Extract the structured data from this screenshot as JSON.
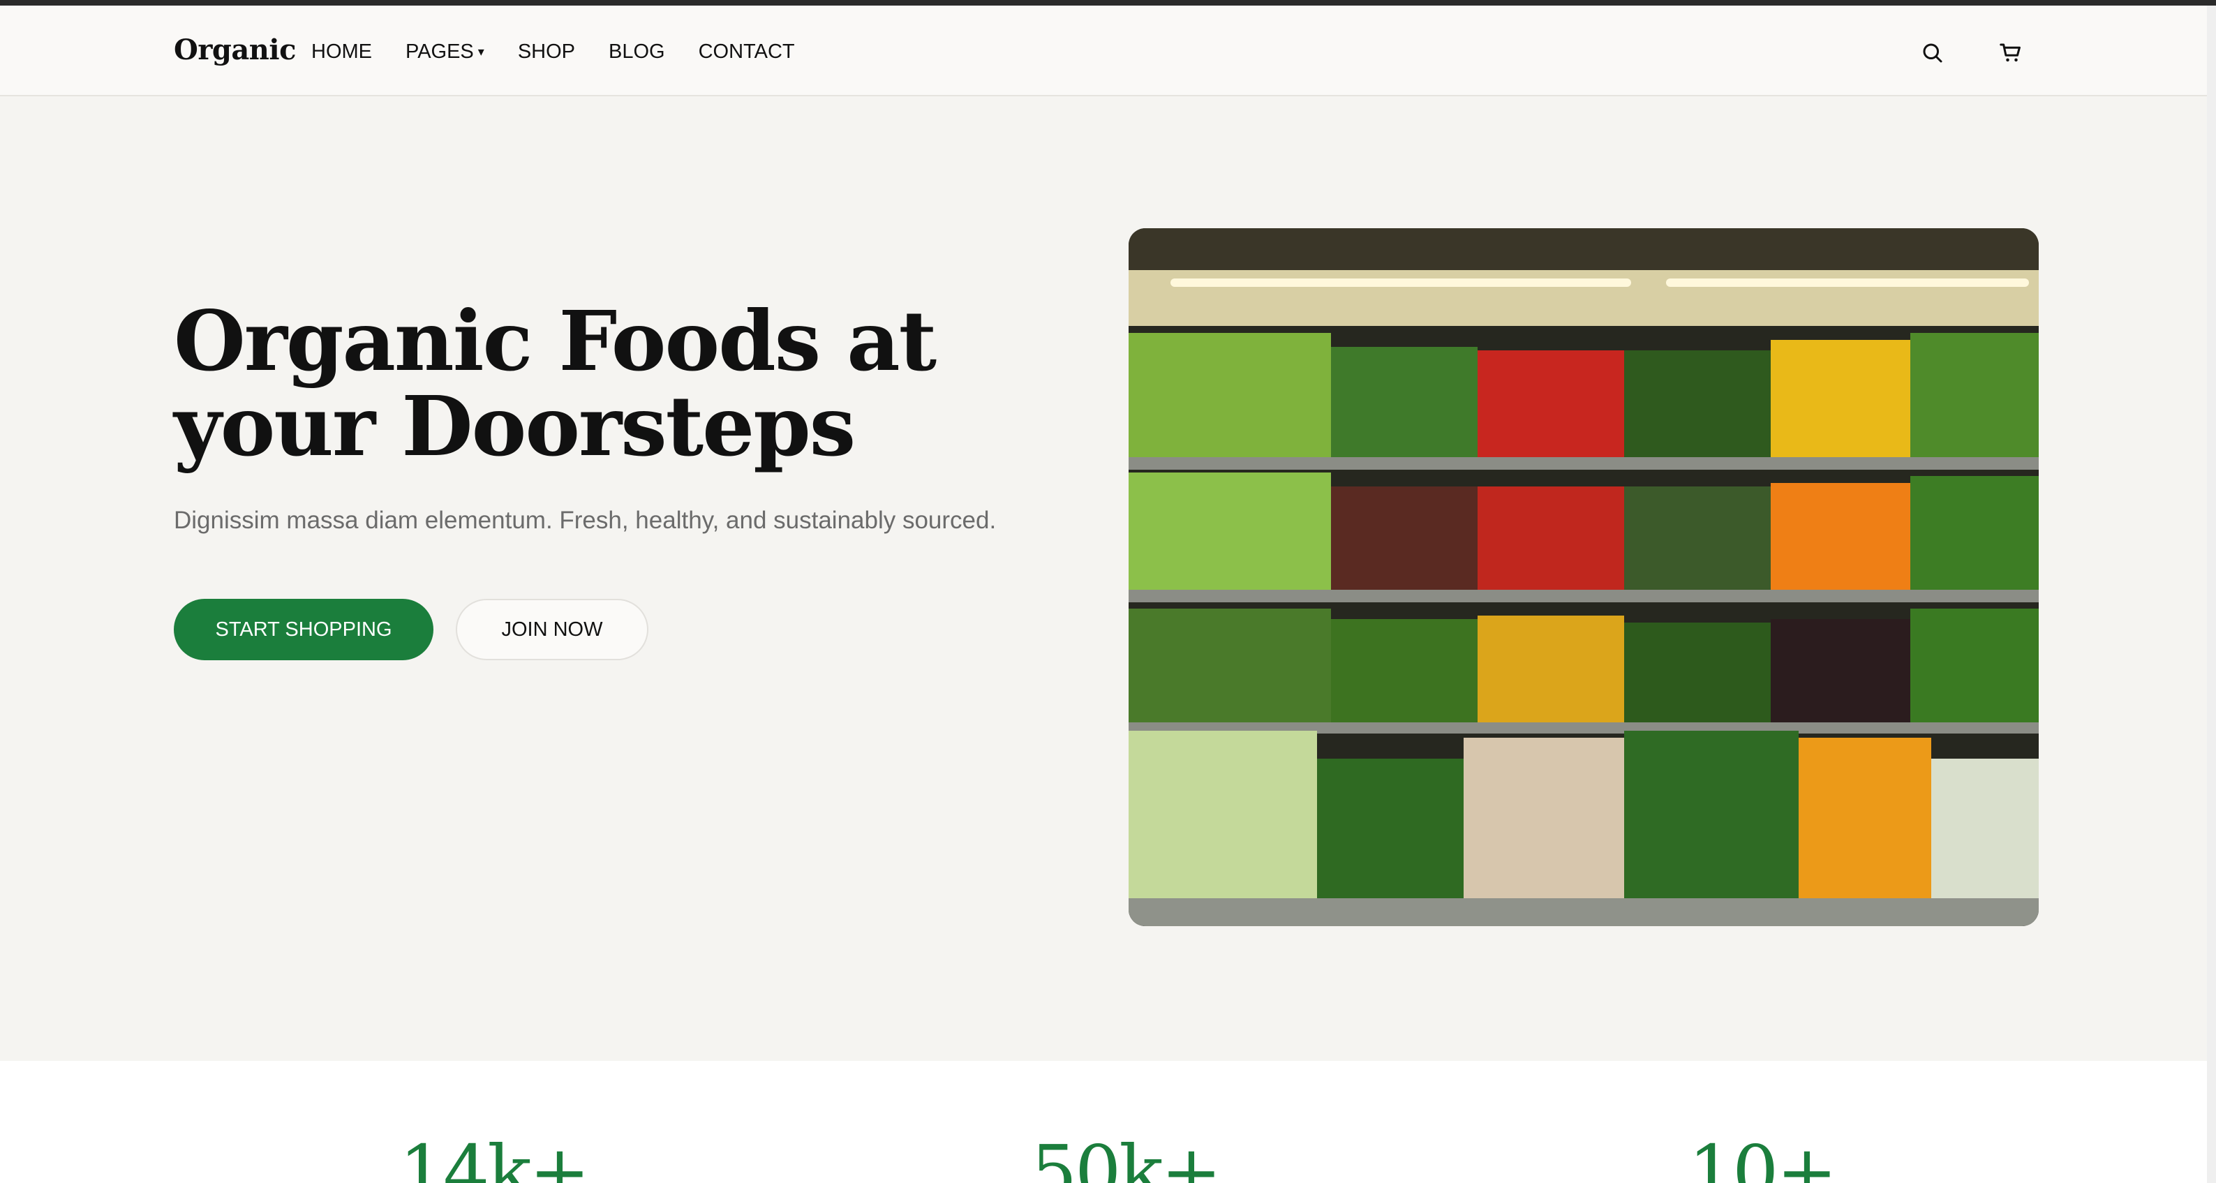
{
  "brand": {
    "logo": "Organic"
  },
  "nav": {
    "items": [
      {
        "label": "HOME"
      },
      {
        "label": "PAGES",
        "has_dropdown": true
      },
      {
        "label": "SHOP"
      },
      {
        "label": "BLOG"
      },
      {
        "label": "CONTACT"
      }
    ],
    "icons": [
      "search-icon",
      "cart-icon"
    ],
    "dropdown_caret": "▾"
  },
  "hero": {
    "title": "Organic Foods at your Doorsteps",
    "subtitle": "Dignissim massa diam elementum. Fresh, healthy, and sustainably sourced.",
    "primary_button": "START SHOPPING",
    "secondary_button": "JOIN NOW",
    "image_subject": "vegetable shelves in a grocery store"
  },
  "stats": [
    {
      "value": "14k+"
    },
    {
      "value": "50k+"
    },
    {
      "value": "10+"
    }
  ],
  "colors": {
    "accent": "#1b7e3c",
    "hero_background": "#f5f4f1",
    "header_background": "#faf9f7",
    "subtitle_text": "#6b6b6b"
  }
}
